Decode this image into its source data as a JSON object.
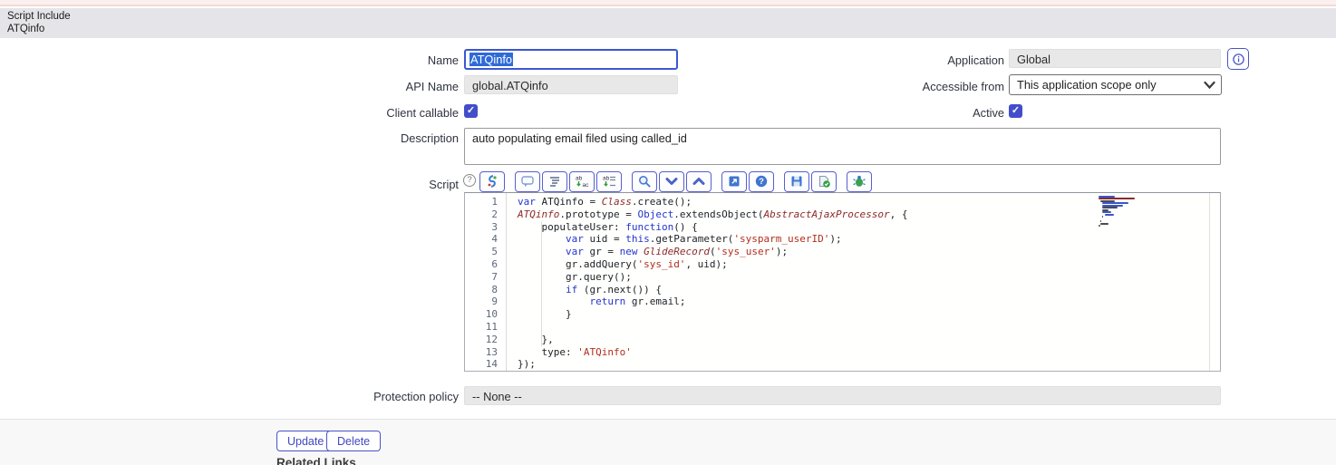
{
  "header": {
    "type_label": "Script Include",
    "record_name": "ATQinfo"
  },
  "fields": {
    "name": {
      "label": "Name",
      "value": "ATQinfo"
    },
    "api_name": {
      "label": "API Name",
      "value": "global.ATQinfo"
    },
    "client_callable": {
      "label": "Client callable",
      "checked": true
    },
    "application": {
      "label": "Application",
      "value": "Global"
    },
    "accessible_from": {
      "label": "Accessible from",
      "value": "This application scope only"
    },
    "active": {
      "label": "Active",
      "checked": true
    },
    "description": {
      "label": "Description",
      "value": "auto populating email filed using called_id"
    },
    "script": {
      "label": "Script"
    },
    "protection_policy": {
      "label": "Protection policy",
      "value": "-- None --"
    }
  },
  "script_toolbar": {
    "help_glyph": "?",
    "buttons": [
      {
        "icon": "syntax-editor-toggle-icon",
        "new_group": false
      },
      {
        "icon": "toggle-comment-icon",
        "new_group": true
      },
      {
        "icon": "format-code-icon",
        "new_group": false
      },
      {
        "icon": "replace-icon",
        "new_group": false
      },
      {
        "icon": "replace-all-icon",
        "new_group": false
      },
      {
        "icon": "search-icon",
        "new_group": true
      },
      {
        "icon": "find-next-icon",
        "new_group": false
      },
      {
        "icon": "find-previous-icon",
        "new_group": false
      },
      {
        "icon": "open-in-new-window-icon",
        "new_group": true
      },
      {
        "icon": "editor-help-icon",
        "new_group": false
      },
      {
        "icon": "save-icon",
        "new_group": true
      },
      {
        "icon": "check-syntax-icon",
        "new_group": false
      },
      {
        "icon": "debug-icon",
        "new_group": true
      }
    ]
  },
  "code": {
    "lines": [
      {
        "n": 1,
        "tokens": [
          [
            "kw",
            "var"
          ],
          [
            "pl",
            " ATQinfo = "
          ],
          [
            "cls",
            "Class"
          ],
          [
            "pl",
            ".create();"
          ]
        ]
      },
      {
        "n": 2,
        "tokens": [
          [
            "cls",
            "ATQinfo"
          ],
          [
            "pl",
            ".prototype = "
          ],
          [
            "kw",
            "Object"
          ],
          [
            "pl",
            ".extendsObject("
          ],
          [
            "cls",
            "AbstractAjaxProcessor"
          ],
          [
            "pl",
            ", {"
          ]
        ]
      },
      {
        "n": 3,
        "tokens": [
          [
            "pl",
            "    populateUser: "
          ],
          [
            "kw",
            "function"
          ],
          [
            "pl",
            "() {"
          ]
        ]
      },
      {
        "n": 4,
        "tokens": [
          [
            "pl",
            "        "
          ],
          [
            "kw",
            "var"
          ],
          [
            "pl",
            " uid = "
          ],
          [
            "kw",
            "this"
          ],
          [
            "pl",
            ".getParameter("
          ],
          [
            "str",
            "'sysparm_userID'"
          ],
          [
            "pl",
            ");"
          ]
        ]
      },
      {
        "n": 5,
        "tokens": [
          [
            "pl",
            "        "
          ],
          [
            "kw",
            "var"
          ],
          [
            "pl",
            " gr = "
          ],
          [
            "kw",
            "new"
          ],
          [
            "pl",
            " "
          ],
          [
            "cls",
            "GlideRecord"
          ],
          [
            "pl",
            "("
          ],
          [
            "str",
            "'sys_user'"
          ],
          [
            "pl",
            ");"
          ]
        ]
      },
      {
        "n": 6,
        "tokens": [
          [
            "pl",
            "        gr.addQuery("
          ],
          [
            "str",
            "'sys_id'"
          ],
          [
            "pl",
            ", uid);"
          ]
        ]
      },
      {
        "n": 7,
        "tokens": [
          [
            "pl",
            "        gr.query();"
          ]
        ]
      },
      {
        "n": 8,
        "tokens": [
          [
            "pl",
            "        "
          ],
          [
            "kw",
            "if"
          ],
          [
            "pl",
            " (gr.next()) {"
          ]
        ]
      },
      {
        "n": 9,
        "tokens": [
          [
            "pl",
            "            "
          ],
          [
            "kw",
            "return"
          ],
          [
            "pl",
            " gr.email;"
          ]
        ]
      },
      {
        "n": 10,
        "tokens": [
          [
            "pl",
            "        }"
          ]
        ]
      },
      {
        "n": 11,
        "tokens": []
      },
      {
        "n": 12,
        "tokens": [
          [
            "pl",
            "    },"
          ]
        ]
      },
      {
        "n": 13,
        "tokens": [
          [
            "pl",
            "    type: "
          ],
          [
            "str",
            "'ATQinfo'"
          ]
        ]
      },
      {
        "n": 14,
        "tokens": [
          [
            "pl",
            "});"
          ]
        ]
      }
    ]
  },
  "footer": {
    "update_label": "Update",
    "delete_label": "Delete",
    "related_links_label": "Related Links"
  },
  "colors": {
    "accent": "#4a53c8",
    "checkbox": "#444dc9",
    "focused_border": "#3b57d0",
    "selection": "#2f6bd8",
    "keyword": "#2434cf",
    "classname": "#8b2a2a",
    "string": "#b22e1f",
    "header_band": "#e5e5e9",
    "pink_strip": "#fcf0ee"
  }
}
